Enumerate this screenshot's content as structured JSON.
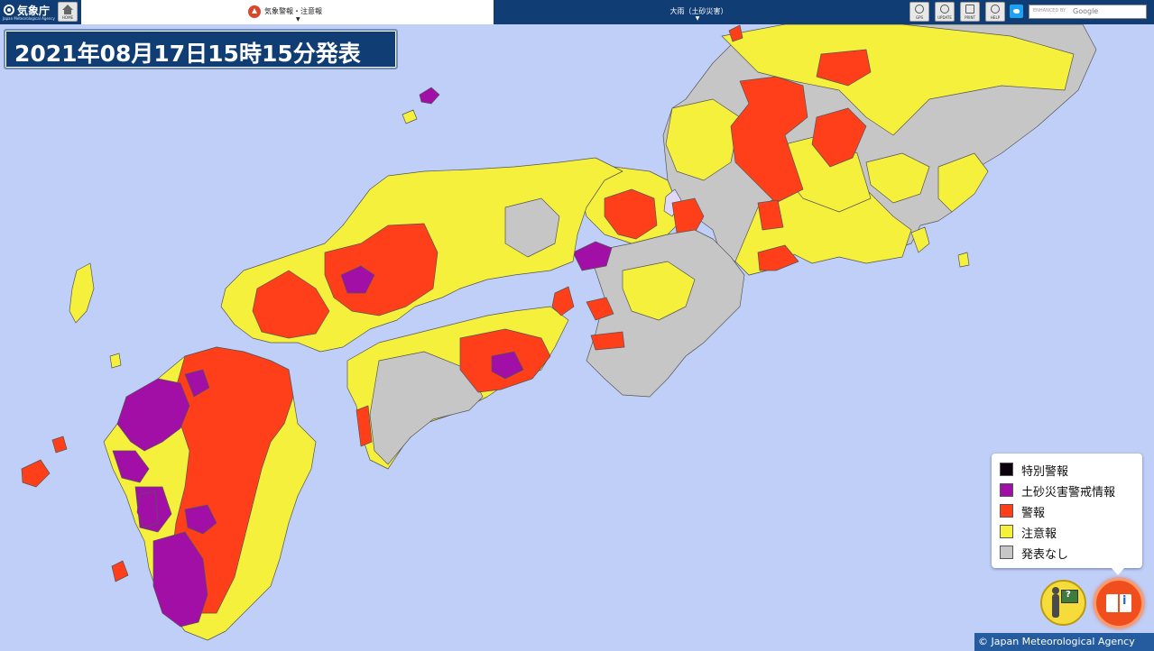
{
  "header": {
    "agency_name": "気象庁",
    "agency_sub": "Japan Meteorological Agency",
    "home_label": "HOME",
    "warning_tab_label": "気象警報・注意報",
    "element_tab_label": "大雨（土砂災害）",
    "caret": "▼",
    "tools": [
      {
        "label": "GPS",
        "icon": "gps-icon"
      },
      {
        "label": "UPDATE",
        "icon": "update-icon"
      },
      {
        "label": "PRINT",
        "icon": "print-icon"
      },
      {
        "label": "HELP",
        "icon": "help-icon"
      }
    ],
    "search_placeholder": "ENHANCED BY",
    "search_brand": "Google"
  },
  "map": {
    "title": "2021年08月17日15時15分発表",
    "region_shown": "西日本",
    "colors": {
      "sea": "#bfcff8",
      "emergency": "#0c000c",
      "landslide": "#a20fa6",
      "warning": "#ff3f1a",
      "advisory": "#f5f03b",
      "none": "#c6c6c6",
      "lake": "#e0d8f8"
    }
  },
  "legend": {
    "items": [
      {
        "label": "特別警報",
        "color": "#0c000c"
      },
      {
        "label": "土砂災害警戒情報",
        "color": "#a20fa6"
      },
      {
        "label": "警報",
        "color": "#ff3f1a"
      },
      {
        "label": "注意報",
        "color": "#f5f03b"
      },
      {
        "label": "発表なし",
        "color": "#c6c6c6"
      }
    ]
  },
  "controls": {
    "help_icon": "person-board-icon",
    "legend_icon": "book-info-icon"
  },
  "credit": "© Japan Meteorological Agency"
}
